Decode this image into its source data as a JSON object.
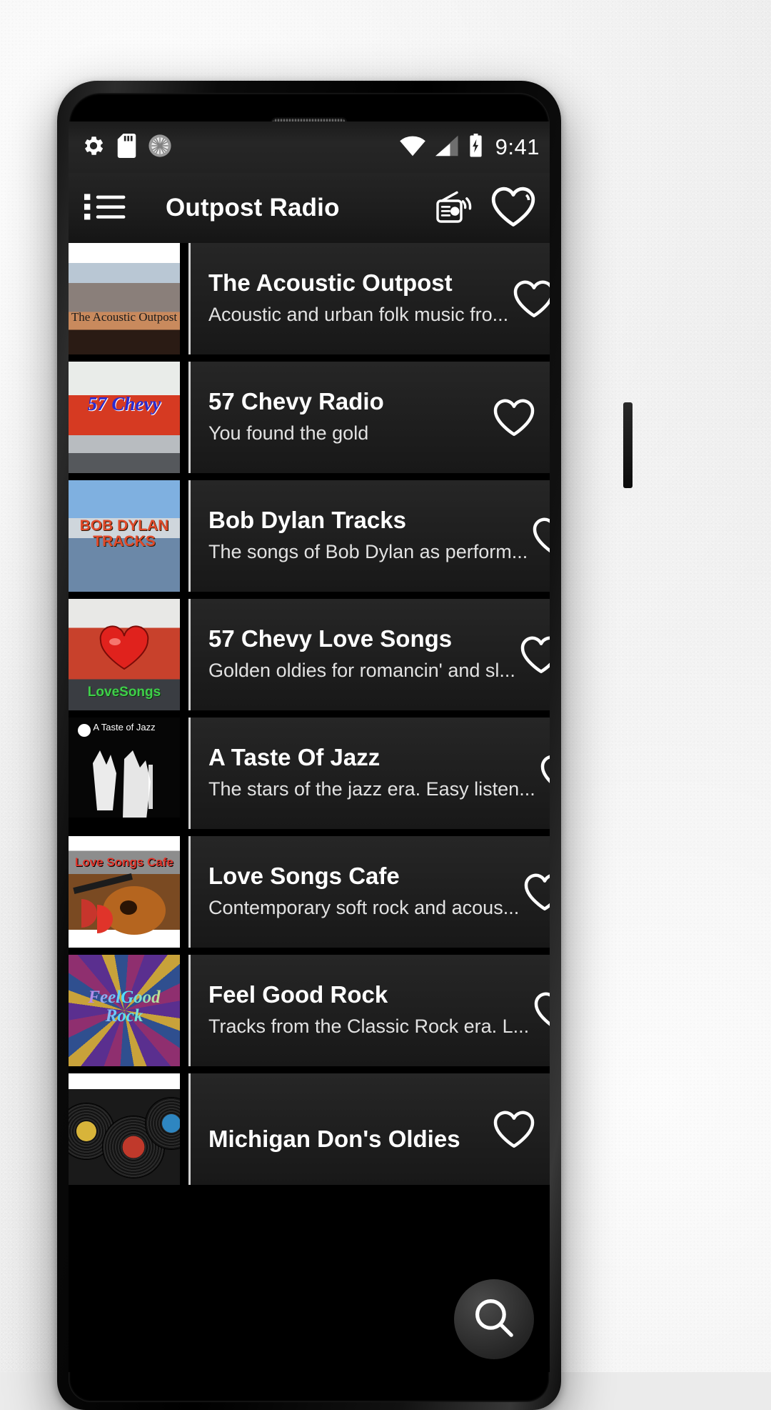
{
  "status_bar": {
    "time": "9:41",
    "left_icons": [
      "settings-gear-icon",
      "sd-card-icon",
      "brightness-icon"
    ],
    "right_icons": [
      "wifi-icon",
      "cellular-signal-icon",
      "battery-charging-icon"
    ]
  },
  "toolbar": {
    "menu_icon": "list-menu-icon",
    "title": "Outpost Radio",
    "radio_icon": "radio-icon",
    "favorites_icon": "heart-outline-icon"
  },
  "fab": {
    "icon": "search-icon"
  },
  "stations": [
    {
      "name": "The Acoustic Outpost",
      "description": "Acoustic and urban folk music fro...",
      "artwork_text": "The Acoustic Outpost",
      "art_class": "art-acoustic",
      "favorite": false
    },
    {
      "name": "57 Chevy Radio",
      "description": "You found the gold",
      "artwork_text": "57 Chevy",
      "art_class": "art-chevy",
      "favorite": false
    },
    {
      "name": "Bob Dylan Tracks",
      "description": "The songs of Bob Dylan as perform...",
      "artwork_text": "BOB DYLAN\nTRACKS",
      "art_class": "art-dylan",
      "favorite": false
    },
    {
      "name": "57 Chevy Love Songs",
      "description": "Golden oldies for romancin' and sl...",
      "artwork_text": "LoveSongs",
      "art_class": "art-lovesongs",
      "favorite": false
    },
    {
      "name": "A Taste Of Jazz",
      "description": "The stars of the jazz era. Easy listen...",
      "artwork_text": "A Taste of Jazz",
      "art_class": "art-jazz",
      "favorite": false
    },
    {
      "name": "Love Songs Cafe",
      "description": "Contemporary soft rock and acous...",
      "artwork_text": "Love Songs Cafe",
      "art_class": "art-cafe",
      "favorite": false
    },
    {
      "name": "Feel Good Rock",
      "description": "Tracks from the Classic Rock era.  L...",
      "artwork_text": "FeelGood\nRock",
      "art_class": "art-feelgood",
      "favorite": false
    },
    {
      "name": "Michigan Don's Oldies",
      "description": "",
      "artwork_text": "",
      "art_class": "art-oldies",
      "favorite": false
    }
  ],
  "colors": {
    "screen_bg": "#000000",
    "card_bg": "#212121",
    "accent_rail": "#cfcfcf",
    "text_primary": "#ffffff",
    "text_secondary": "#e2e2e2"
  }
}
